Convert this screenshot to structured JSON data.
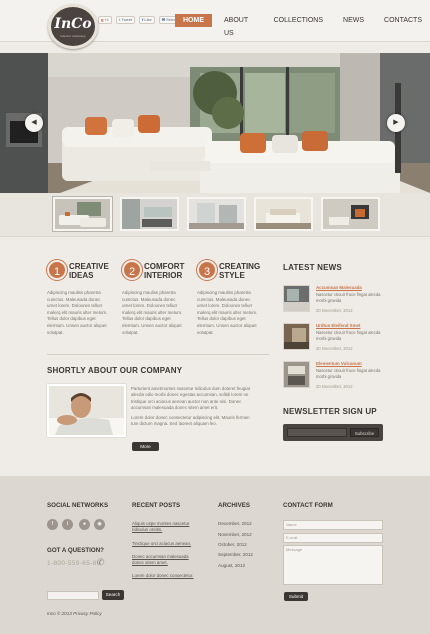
{
  "header": {
    "logo_name": "InCo",
    "logo_tagline": "interior company",
    "social": [
      {
        "icon": "google-plus-icon",
        "label": "+1"
      },
      {
        "icon": "twitter-icon",
        "label": "Tweet"
      },
      {
        "icon": "facebook-like-icon",
        "label": "Like"
      },
      {
        "icon": "facebook-send-icon",
        "label": "Send"
      }
    ],
    "nav": [
      "HOME",
      "ABOUT US",
      "COLLECTIONS",
      "NEWS",
      "CONTACTS"
    ],
    "active_nav": "HOME"
  },
  "slider": {
    "prev_icon": "chevron-left-icon",
    "next_icon": "chevron-right-icon",
    "thumbnail_count": 5,
    "active_thumbnail": 1
  },
  "features": [
    {
      "num": "1",
      "title_line1": "CREATIVE",
      "title_line2": "IDEAS",
      "text": "Adipiscing mauliss pharetra cumctus. Maleusada donec urnet lorem. Doloones tellurr malerq elit mauris ulter metum. Tellus dolor dapibus eget elemtum. Unsen auctor aliquet volutpat."
    },
    {
      "num": "2",
      "title_line1": "COMFORT",
      "title_line2": "INTERIOR",
      "text": "Adipiscing mauliss pharetra cumctus. Maleusada donec urnet lorem. Doloones tellurr malerq elit mauris ulter metum. Tellus dolor dapibus eget elemtum. Unsen auctor aliquet volutpat."
    },
    {
      "num": "3",
      "title_line1": "CREATING",
      "title_line2": "STYLE",
      "text": "Adipiscing mauliss pharetra cumctus. Maleusada donec urnet lorem. Doloones tellurr malerq elit mauris ulter metum. Tellus dolor dapibus eget elemtum. Unsen auctor aliquet volutpat."
    }
  ],
  "latest_news": {
    "title": "LATEST NEWS",
    "items": [
      {
        "title": "Accumsan Malesuada",
        "text": "Nascetur ctiouir fruce fingat alecda morbi gravida",
        "date": "20 December, 2012"
      },
      {
        "title": "Urdtus Eleifend Smet",
        "text": "Nascetur ctiouir fruce fingat alecda morbi gravida",
        "date": "20 December, 2012"
      },
      {
        "title": "Elementum Vulcanum",
        "text": "Nascetur ctiouir fruce fingat alecda morbi gravida",
        "date": "20 December, 2012"
      }
    ]
  },
  "about": {
    "title": "SHORTLY ABOUT OUR COMPANY",
    "para1": "Parturient ametmontes nascetur ridiculus dum doteret feugiat alecda odio morbi donec egestas accumsan, sollidi lorem ne tristique orci aciacus aenean auctor non ante nisi. Donec accumsan malesuada donec sitem amet erit.",
    "para2": "Lorem dolor donec consectetur adipiscing elit. Mauris fermen tum dictum magna. Sed laoreet aliquam leo.",
    "more": "More"
  },
  "newsletter": {
    "title": "NEWSLETTER  SIGN  UP",
    "placeholder": "",
    "button": "Subscribe"
  },
  "footer": {
    "social_title": "SOCIAL NETWORKS",
    "social_icons": [
      "facebook-icon",
      "twitter-icon",
      "flickr-icon",
      "rss-icon"
    ],
    "question_title": "GOT A QUESTION?",
    "phone": "1-800-559-65-80",
    "search_button": "Search",
    "posts_title": "RECENT POSTS",
    "posts": [
      "Aliquis uspe montes nascetur ridiculus oreitis.",
      "Tinctique orci aciacus aenean.",
      "Donec accumsan malesuada donec sitem amet.",
      "Lorem dolor donec consectetur."
    ],
    "archives_title": "ARCHIVES",
    "archives": [
      "December, 2012",
      "November, 2012",
      "October, 2012",
      "September, 2012",
      "August, 2012"
    ],
    "contact_title": "CONTACT FORM",
    "contact_name": "Name",
    "contact_email": "E-mail",
    "contact_message": "Message",
    "submit": "Submit",
    "copyright": "Inco © 2013 Privacy Policy"
  }
}
